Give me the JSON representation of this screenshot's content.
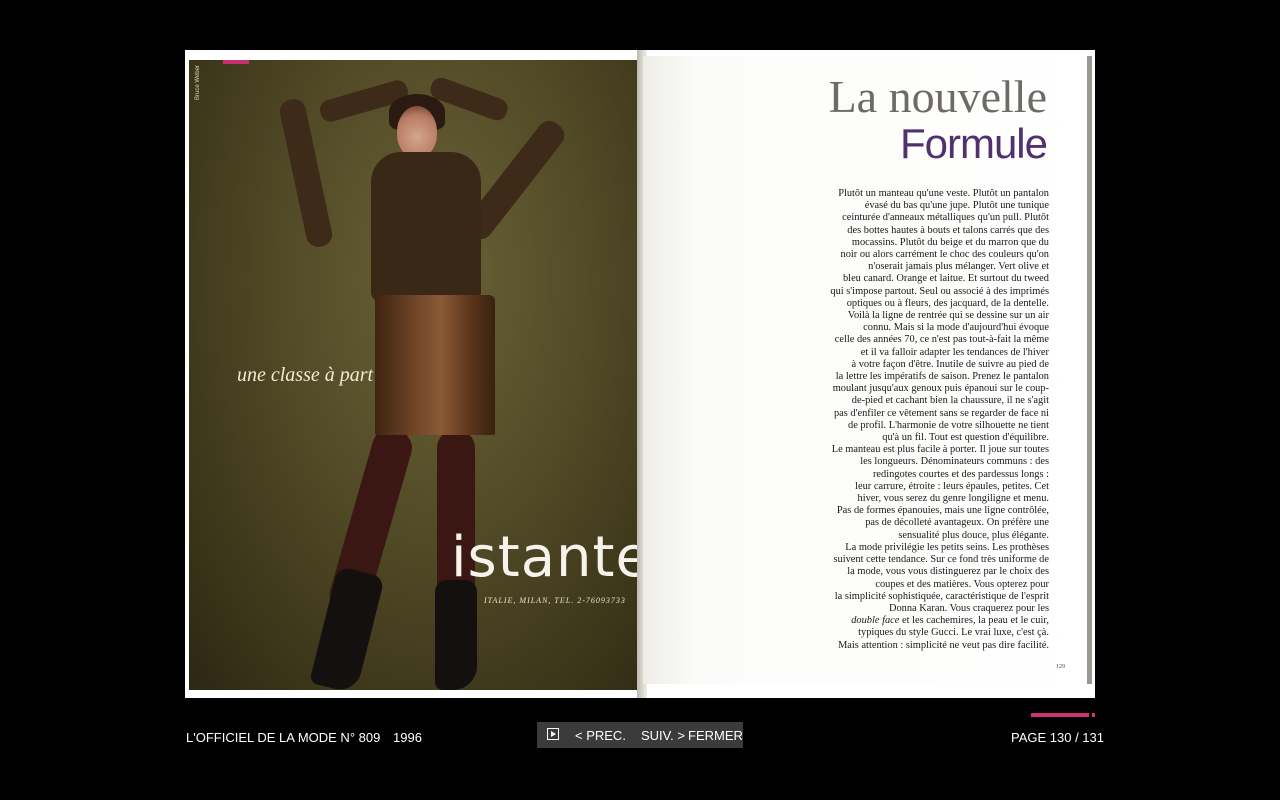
{
  "left_page": {
    "photographer": "Bruce Weber",
    "tagline": "une classe à part",
    "brand": "istante",
    "brand_address": "ITALIE, MILAN, TEL. 2-76093733"
  },
  "right_page": {
    "title_line1": "La nouvelle",
    "title_line2": "Formule",
    "article_lines": [
      "Plutôt un manteau qu'une veste. Plutôt un pantalon",
      "évasé du bas qu'une jupe. Plutôt une tunique",
      "ceinturée d'anneaux métalliques qu'un pull. Plutôt",
      "des bottes hautes à bouts et talons carrés que des",
      "mocassins. Plutôt du beige et du marron que du",
      "noir ou alors carrément le choc des couleurs qu'on",
      "n'oserait jamais plus mélanger. Vert olive et",
      "bleu canard. Orange et laitue. Et surtout du tweed",
      "qui s'impose partout. Seul ou associé à des imprimés",
      "optiques ou à fleurs, des jacquard, de la dentelle.",
      "Voilà la ligne de rentrée qui se dessine sur un air",
      "connu. Mais si la mode d'aujourd'hui évoque",
      "celle des années 70, ce n'est pas tout-à-fait la même",
      "et il va falloir adapter les tendances de l'hiver",
      "à votre façon d'être. Inutile de suivre au pied de",
      "la lettre les impératifs de saison. Prenez le pantalon",
      "moulant jusqu'aux genoux puis épanoui sur le coup-",
      "de-pied et cachant bien la chaussure, il ne s'agit",
      "pas d'enfiler ce vêtement sans se regarder de face ni",
      "de profil. L'harmonie de votre silhouette ne tient",
      "qu'à un fil. Tout est question d'équilibre.",
      "Le manteau est plus facile à porter. Il joue sur toutes",
      "les longueurs. Dénominateurs communs : des",
      "redingotes courtes et des pardessus longs :",
      "leur carrure, étroite : leurs épaules, petites. Cet",
      "hiver, vous serez du genre longiligne et menu.",
      "Pas de formes épanouies, mais une ligne contrôlée,",
      "pas de décolleté avantageux. On préfère une",
      "sensualité plus douce, plus élégante.",
      "La mode privilégie les petits seins. Les prothèses",
      "suivent cette tendance. Sur ce fond très uniforme de",
      "la mode, vous vous distinguerez par le choix des",
      "coupes et des matières. Vous opterez pour",
      "la simplicité sophistiquée, caractéristique de l'esprit",
      "Donna Karan. Vous craquerez pour les",
      "double face et les cachemires, la peau et le cuir,",
      "typiques du style Gucci. Le vrai luxe, c'est çà.",
      "Mais attention : simplicité ne veut pas dire facilité."
    ],
    "page_number": "129"
  },
  "footer": {
    "magazine_title": "L'OFFICIEL DE LA MODE N° 809",
    "year": "1996",
    "play_icon": "play-icon",
    "prev_label": "< PREC.",
    "next_label": "SUIV. >",
    "close_label": "FERMER",
    "page_label": "PAGE 130 / 131",
    "accent_color": "#d03373"
  }
}
